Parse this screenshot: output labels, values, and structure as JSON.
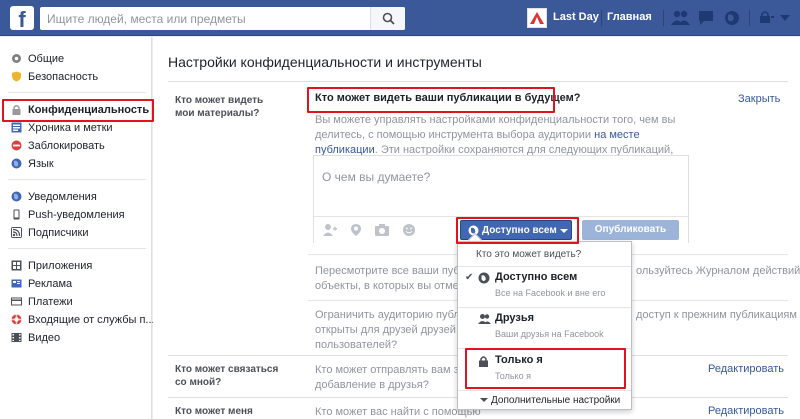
{
  "header": {
    "logo": "f",
    "search_placeholder": "Ищите людей, места или предметы",
    "user_name": "Last Day",
    "home_link": "Главная"
  },
  "sidebar": {
    "group1": [
      {
        "label": "Общие",
        "icon": "gear-icon",
        "color": "#7f7f7f"
      },
      {
        "label": "Безопасность",
        "icon": "shield-icon",
        "color": "#f0b429"
      }
    ],
    "group2": [
      {
        "label": "Конфиденциальность",
        "icon": "lock-icon",
        "color": "#bdbdbd",
        "active": true
      },
      {
        "label": "Хроника и метки",
        "icon": "timeline-icon",
        "color": "#4267b2"
      },
      {
        "label": "Заблокировать",
        "icon": "block-icon",
        "color": "#d93f3f"
      },
      {
        "label": "Язык",
        "icon": "globe-icon",
        "color": "#4267b2"
      }
    ],
    "group3": [
      {
        "label": "Уведомления",
        "icon": "globe-notif-icon",
        "color": "#4267b2"
      },
      {
        "label": "Push-уведомления",
        "icon": "phone-icon",
        "color": "#4b4f56"
      },
      {
        "label": "Подписчики",
        "icon": "rss-icon",
        "color": "#4b4f56"
      }
    ],
    "group4": [
      {
        "label": "Приложения",
        "icon": "apps-icon",
        "color": "#4b4f56"
      },
      {
        "label": "Реклама",
        "icon": "ads-icon",
        "color": "#4267b2"
      },
      {
        "label": "Платежи",
        "icon": "card-icon",
        "color": "#4b4f56"
      },
      {
        "label": "Входящие от службы п...",
        "icon": "lifebuoy-icon",
        "color": "#d93f3f"
      },
      {
        "label": "Видео",
        "icon": "video-icon",
        "color": "#4b4f56"
      }
    ]
  },
  "main": {
    "title": "Настройки конфиденциальности и инструменты",
    "section1_label": "Кто может видеть мои материалы?",
    "question": "Кто может видеть ваши публикации в будущем?",
    "close_link": "Закрыть",
    "desc_part1": "Вы можете управлять настройками конфиденциальности того, чем вы делитесь, с помощью инструмента выбора аудитории ",
    "desc_link": "на месте публикации",
    "desc_part2": ". Эти настройки сохраняются для следующих публикаций, если вы их не измените.",
    "composer_placeholder": "О чем вы думаете?",
    "audience_button": "Доступно всем",
    "post_button": "Опубликовать",
    "row1_left_l1": "Пересмотрите все ваши публика",
    "row1_left_l2": "объекты, в которых вы отмече",
    "row1_right": "ользуйтесь Журналом действий",
    "row2_left_l1": "Ограничить аудиторию публик",
    "row2_left_l2": "открыты для друзей друзей ил",
    "row2_left_l3": "пользователей?",
    "row2_right": "доступ к прежним публикациям",
    "section2_label": "Кто может связаться со мной?",
    "section2_text_l1": "Кто может отправлять вам запр",
    "section2_text_l2": "добавление в друзья?",
    "section2_edit": "Редактировать",
    "section3_label": "Кто может меня найти?",
    "section3_text": "Кто может вас найти с помощью",
    "section3_edit": "Редактировать"
  },
  "dropdown": {
    "header": "Кто это может видеть?",
    "options": [
      {
        "name": "Доступно всем",
        "sub": "Все на Facebook и вне его",
        "checked": true
      },
      {
        "name": "Друзья",
        "sub": "Ваши друзья на Facebook",
        "checked": false
      },
      {
        "name": "Только я",
        "sub": "Только я",
        "checked": false
      }
    ],
    "more": "Дополнительные настройки"
  }
}
